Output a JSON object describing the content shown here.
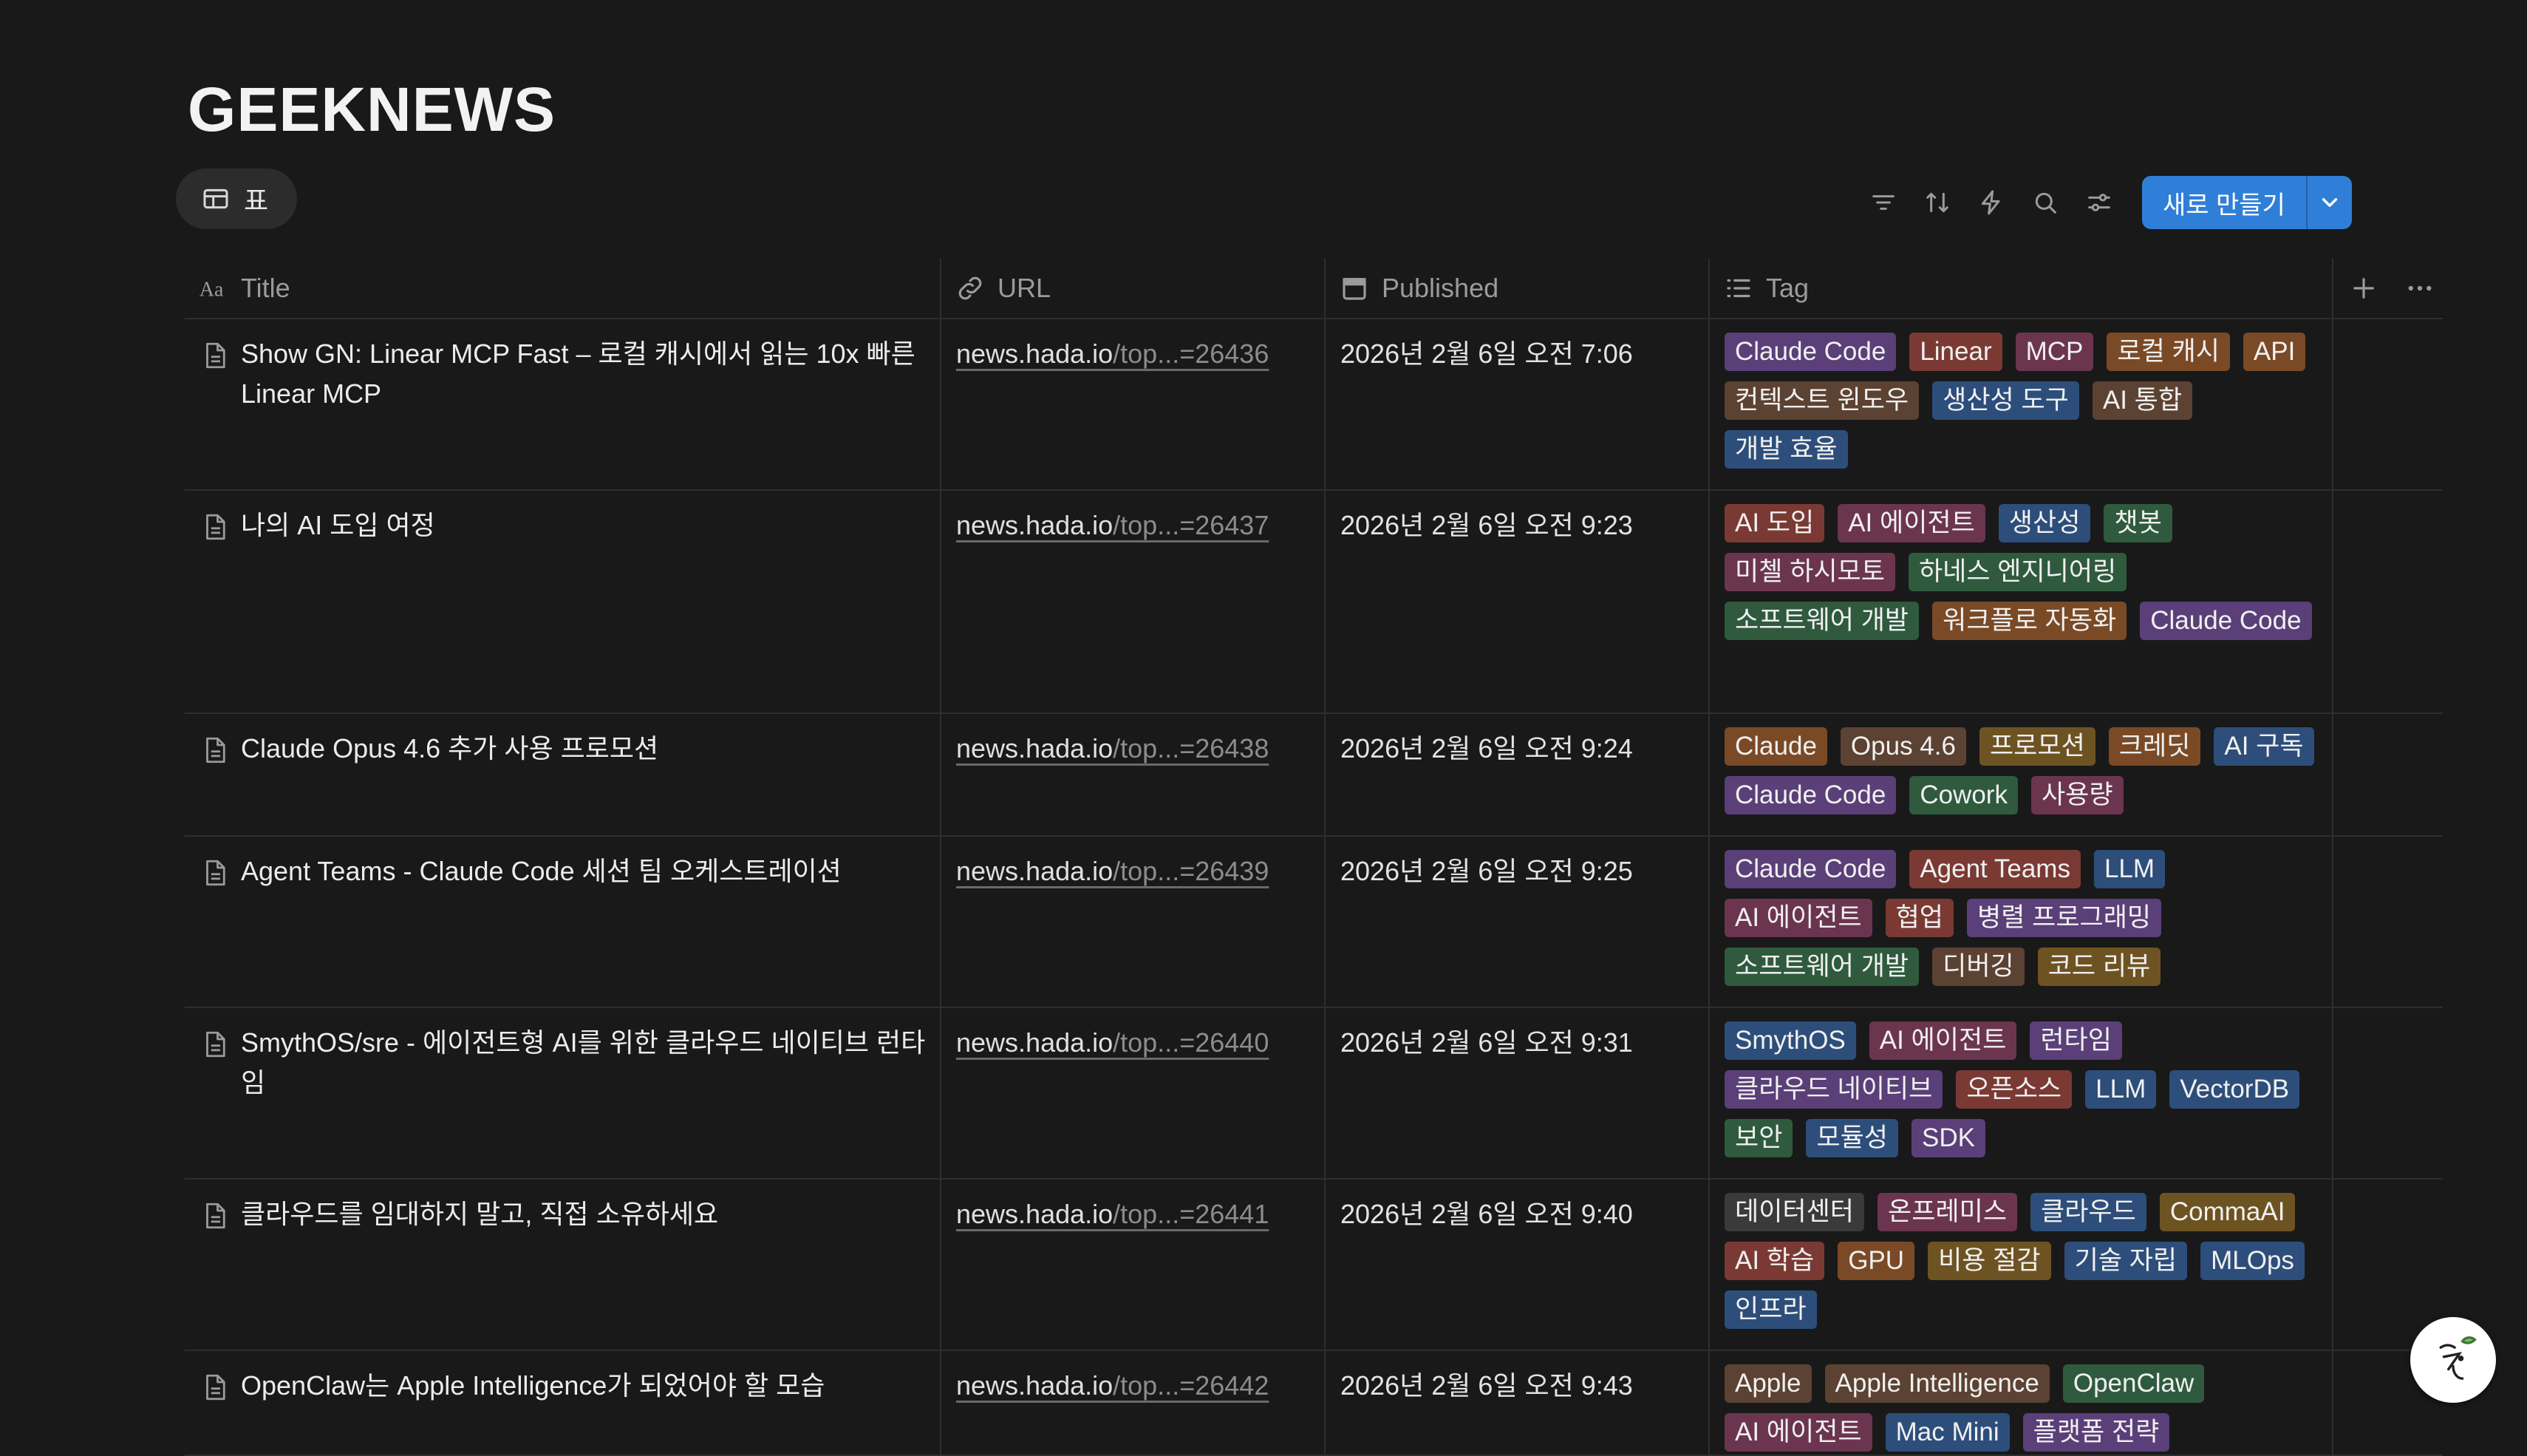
{
  "page_title": "GEEKNEWS",
  "view_tab": {
    "label": "표"
  },
  "toolbar": {
    "new_label": "새로 만들기"
  },
  "columns": {
    "title": "Title",
    "url": "URL",
    "published": "Published",
    "tag": "Tag"
  },
  "tag_colors": {
    "purple": "#5a3f78",
    "red": "#7a3a33",
    "pink": "#6b3550",
    "orange": "#7a4a26",
    "brown": "#5c4232",
    "blue": "#2d4e7a",
    "gray": "#3a3a3a",
    "green": "#2f5a3e",
    "yellow": "#6e5322"
  },
  "accent": "#2f7fd8",
  "rows": [
    {
      "title": "Show GN: Linear MCP Fast – 로컬 캐시에서 읽는 10x 빠른 Linear MCP",
      "url_host": "news.hada.io",
      "url_path": "/top...=26436",
      "published": "2026년 2월 6일 오전 7:06",
      "tags": [
        {
          "label": "Claude Code",
          "color": "purple"
        },
        {
          "label": "Linear",
          "color": "red"
        },
        {
          "label": "MCP",
          "color": "pink"
        },
        {
          "label": "로컬 캐시",
          "color": "orange"
        },
        {
          "label": "API",
          "color": "orange"
        },
        {
          "label": "컨텍스트 윈도우",
          "color": "brown"
        },
        {
          "label": "생산성 도구",
          "color": "blue"
        },
        {
          "label": "AI 통합",
          "color": "brown"
        },
        {
          "label": "개발 효율",
          "color": "blue"
        }
      ]
    },
    {
      "title": "나의 AI 도입 여정",
      "url_host": "news.hada.io",
      "url_path": "/top...=26437",
      "published": "2026년 2월 6일 오전 9:23",
      "tags": [
        {
          "label": "AI 도입",
          "color": "red"
        },
        {
          "label": "AI 에이전트",
          "color": "pink"
        },
        {
          "label": "생산성",
          "color": "blue"
        },
        {
          "label": "챗봇",
          "color": "green"
        },
        {
          "label": "미첼 하시모토",
          "color": "pink"
        },
        {
          "label": "하네스 엔지니어링",
          "color": "green"
        },
        {
          "label": "소프트웨어 개발",
          "color": "green"
        },
        {
          "label": "워크플로 자동화",
          "color": "orange"
        },
        {
          "label": "Claude Code",
          "color": "purple"
        }
      ]
    },
    {
      "title": "Claude Opus 4.6 추가 사용 프로모션",
      "url_host": "news.hada.io",
      "url_path": "/top...=26438",
      "published": "2026년 2월 6일 오전 9:24",
      "tags": [
        {
          "label": "Claude",
          "color": "orange"
        },
        {
          "label": "Opus 4.6",
          "color": "brown"
        },
        {
          "label": "프로모션",
          "color": "yellow"
        },
        {
          "label": "크레딧",
          "color": "orange"
        },
        {
          "label": "AI 구독",
          "color": "blue"
        },
        {
          "label": "Claude Code",
          "color": "purple"
        },
        {
          "label": "Cowork",
          "color": "green"
        },
        {
          "label": "사용량",
          "color": "pink"
        }
      ]
    },
    {
      "title": "Agent Teams - Claude Code 세션 팀 오케스트레이션",
      "url_host": "news.hada.io",
      "url_path": "/top...=26439",
      "published": "2026년 2월 6일 오전 9:25",
      "tags": [
        {
          "label": "Claude Code",
          "color": "purple"
        },
        {
          "label": "Agent Teams",
          "color": "red"
        },
        {
          "label": "LLM",
          "color": "blue"
        },
        {
          "label": "AI 에이전트",
          "color": "pink"
        },
        {
          "label": "협업",
          "color": "red"
        },
        {
          "label": "병렬 프로그래밍",
          "color": "purple"
        },
        {
          "label": "소프트웨어 개발",
          "color": "green"
        },
        {
          "label": "디버깅",
          "color": "brown"
        },
        {
          "label": "코드 리뷰",
          "color": "yellow"
        }
      ]
    },
    {
      "title": "SmythOS/sre - 에이전트형 AI를 위한 클라우드 네이티브 런타임",
      "url_host": "news.hada.io",
      "url_path": "/top...=26440",
      "published": "2026년 2월 6일 오전 9:31",
      "tags": [
        {
          "label": "SmythOS",
          "color": "blue"
        },
        {
          "label": "AI 에이전트",
          "color": "pink"
        },
        {
          "label": "런타임",
          "color": "purple"
        },
        {
          "label": "클라우드 네이티브",
          "color": "purple"
        },
        {
          "label": "오픈소스",
          "color": "red"
        },
        {
          "label": "LLM",
          "color": "blue"
        },
        {
          "label": "VectorDB",
          "color": "blue"
        },
        {
          "label": "보안",
          "color": "green"
        },
        {
          "label": "모듈성",
          "color": "blue"
        },
        {
          "label": "SDK",
          "color": "purple"
        }
      ]
    },
    {
      "title": "클라우드를 임대하지 말고, 직접 소유하세요",
      "url_host": "news.hada.io",
      "url_path": "/top...=26441",
      "published": "2026년 2월 6일 오전 9:40",
      "tags": [
        {
          "label": "데이터센터",
          "color": "gray"
        },
        {
          "label": "온프레미스",
          "color": "pink"
        },
        {
          "label": "클라우드",
          "color": "blue"
        },
        {
          "label": "CommaAI",
          "color": "yellow"
        },
        {
          "label": "AI 학습",
          "color": "red"
        },
        {
          "label": "GPU",
          "color": "orange"
        },
        {
          "label": "비용 절감",
          "color": "yellow"
        },
        {
          "label": "기술 자립",
          "color": "blue"
        },
        {
          "label": "MLOps",
          "color": "blue"
        },
        {
          "label": "인프라",
          "color": "blue"
        }
      ]
    },
    {
      "title": "OpenClaw는 Apple Intelligence가 되었어야 할 모습",
      "url_host": "news.hada.io",
      "url_path": "/top...=26442",
      "published": "2026년 2월 6일 오전 9:43",
      "tags": [
        {
          "label": "Apple",
          "color": "brown"
        },
        {
          "label": "Apple Intelligence",
          "color": "brown"
        },
        {
          "label": "OpenClaw",
          "color": "green"
        },
        {
          "label": "AI 에이전트",
          "color": "pink"
        },
        {
          "label": "Mac Mini",
          "color": "blue"
        },
        {
          "label": "플랫폼 전략",
          "color": "purple"
        }
      ]
    }
  ]
}
